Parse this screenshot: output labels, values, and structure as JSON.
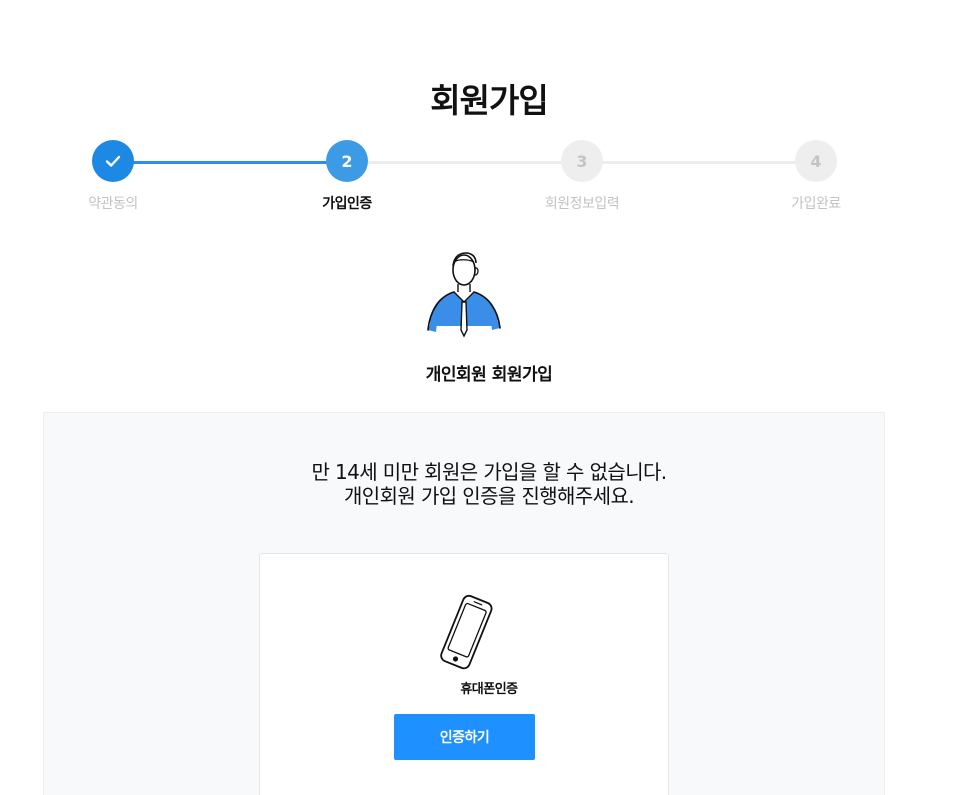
{
  "page_title": "회원가입",
  "steps": [
    {
      "number": "1",
      "label": "약관동의",
      "state": "done"
    },
    {
      "number": "2",
      "label": "가입인증",
      "state": "current"
    },
    {
      "number": "3",
      "label": "회원정보입력",
      "state": "todo"
    },
    {
      "number": "4",
      "label": "가입완료",
      "state": "todo"
    }
  ],
  "member_type": {
    "label": "개인회원 회원가입",
    "icon": "person-illustration"
  },
  "notice": {
    "line1": "만 14세 미만 회원은 가입을 할 수 없습니다.",
    "line2": "개인회원 가입 인증을 진행해주세요."
  },
  "auth": {
    "method_label": "휴대폰인증",
    "icon": "mobile-phone-icon",
    "button_label": "인증하기"
  },
  "colors": {
    "accent": "#1e90ff",
    "step_done": "#1e88e5",
    "step_current": "#3d9be6",
    "step_inactive": "#eeeeee",
    "panel_bg": "#f8f9fb"
  }
}
